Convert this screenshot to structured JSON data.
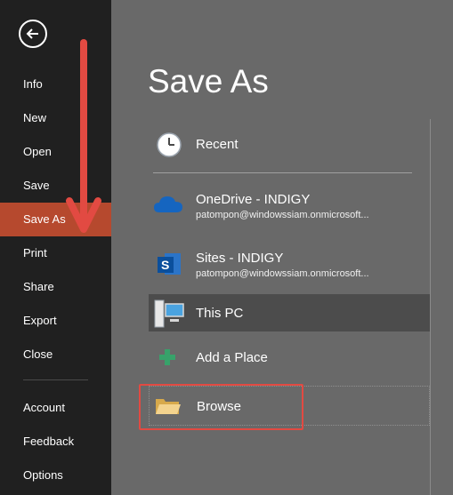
{
  "sidebar": {
    "back_icon": "back-arrow-circle-icon",
    "items": [
      {
        "label": "Info"
      },
      {
        "label": "New"
      },
      {
        "label": "Open"
      },
      {
        "label": "Save"
      },
      {
        "label": "Save As"
      },
      {
        "label": "Print"
      },
      {
        "label": "Share"
      },
      {
        "label": "Export"
      },
      {
        "label": "Close"
      },
      {
        "label": "Account"
      },
      {
        "label": "Feedback"
      },
      {
        "label": "Options"
      }
    ],
    "active_color": "#b6492e",
    "background": "#202020"
  },
  "main": {
    "title": "Save As",
    "places": [
      {
        "name": "Recent",
        "icon": "clock-icon"
      },
      {
        "name": "OneDrive - INDIGY",
        "account": "patompon@windowssiam.onmicrosoft...",
        "icon": "onedrive-cloud-icon"
      },
      {
        "name": "Sites - INDIGY",
        "account": "patompon@windowssiam.onmicrosoft...",
        "icon": "sharepoint-icon"
      },
      {
        "name": "This PC",
        "icon": "computer-icon"
      },
      {
        "name": "Add a Place",
        "icon": "plus-icon"
      },
      {
        "name": "Browse",
        "icon": "folder-icon"
      }
    ],
    "background": "#696969"
  },
  "annotations": {
    "arrow_color": "#e24a42",
    "highlight_color": "#e24a42"
  }
}
